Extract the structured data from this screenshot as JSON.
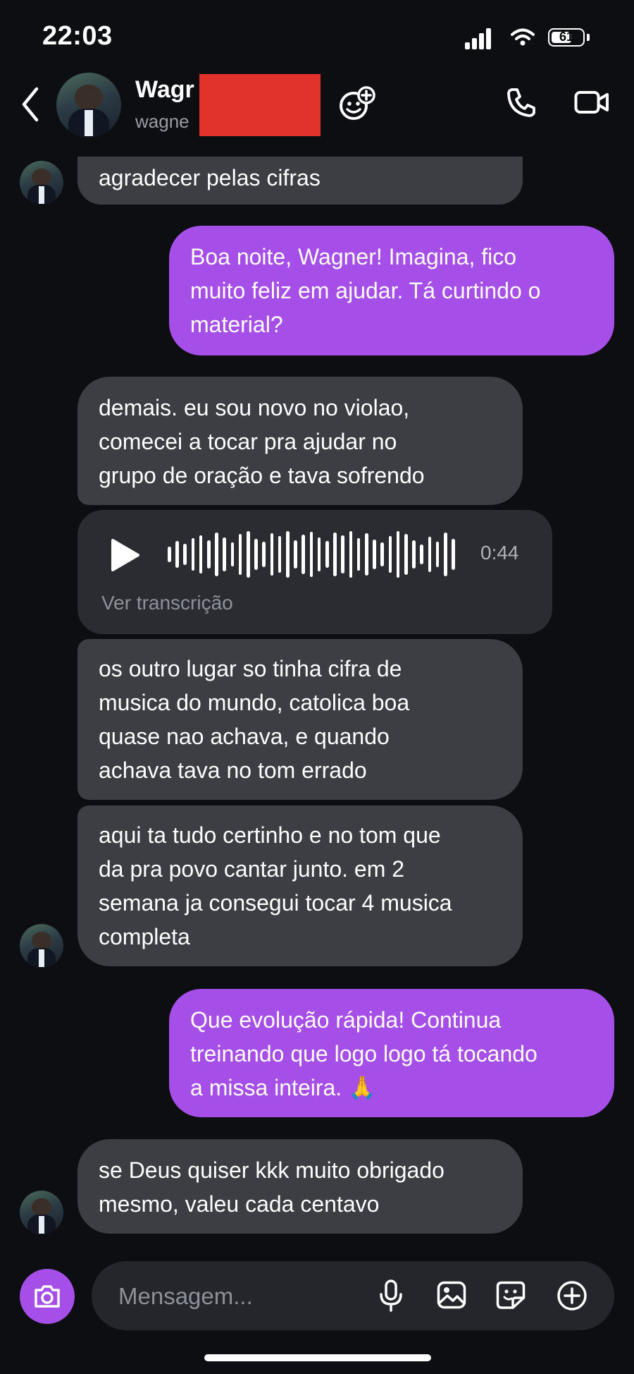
{
  "status_bar": {
    "time": "22:03",
    "battery": "61"
  },
  "header": {
    "name": "Wagr",
    "username": "wagne"
  },
  "messages": {
    "m1": "agradecer pelas cifras",
    "m2": [
      "Boa noite, Wagner! Imagina, fico",
      "muito feliz em ajudar. Tá curtindo o",
      "material?"
    ],
    "m3": [
      "demais. eu sou novo no violao,",
      "comecei a tocar pra ajudar no",
      "grupo de oração e tava sofrendo"
    ],
    "voice": {
      "duration": "0:44",
      "transcript_label": "Ver transcrição"
    },
    "m4": [
      "os outro lugar so tinha cifra de",
      "musica do mundo, catolica boa",
      "quase nao achava, e quando",
      "achava tava no tom errado"
    ],
    "m5": [
      "aqui ta tudo certinho e no tom que",
      "da pra povo cantar junto. em 2",
      "semana ja consegui tocar 4 musica",
      "completa"
    ],
    "m6": [
      "Que evolução rápida! Continua",
      "treinando que logo logo tá tocando",
      "a missa inteira. 🙏"
    ],
    "m7": [
      "se Deus quiser kkk muito obrigado",
      "mesmo, valeu cada centavo"
    ]
  },
  "composer": {
    "placeholder": "Mensagem..."
  },
  "colors": {
    "outgoing": "#a64ee8",
    "incoming": "#3c3e44",
    "background": "#0d0e12"
  },
  "icons": [
    "back-icon",
    "add-people-icon",
    "phone-icon",
    "video-icon",
    "play-icon",
    "camera-icon",
    "microphone-icon",
    "image-icon",
    "sticker-icon",
    "plus-icon"
  ]
}
